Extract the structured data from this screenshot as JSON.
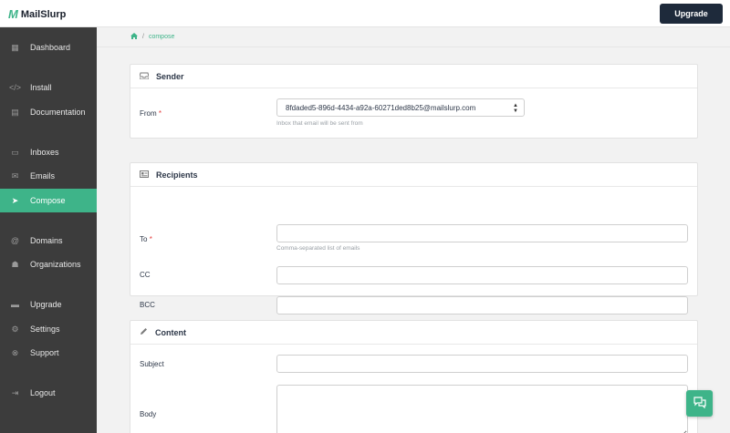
{
  "app": {
    "logo_mark": "M",
    "logo_text": "MailSlurp",
    "upgrade_label": "Upgrade"
  },
  "colors": {
    "accent": "#3eb489",
    "sidebar_bg": "#3c3c3c",
    "header_button": "#1e2a3b",
    "required": "#e53e3e"
  },
  "sidebar": {
    "items": [
      {
        "label": "Dashboard",
        "icon": "dashboard-icon",
        "glyph": "▦"
      },
      {
        "label": "Install",
        "icon": "code-icon",
        "glyph": "</>"
      },
      {
        "label": "Documentation",
        "icon": "book-icon",
        "glyph": "▤"
      },
      {
        "label": "Inboxes",
        "icon": "inbox-icon",
        "glyph": "▭"
      },
      {
        "label": "Emails",
        "icon": "envelope-icon",
        "glyph": "✉"
      },
      {
        "label": "Compose",
        "icon": "paper-plane-icon",
        "glyph": "➤",
        "active": true
      },
      {
        "label": "Domains",
        "icon": "at-icon",
        "glyph": "@"
      },
      {
        "label": "Organizations",
        "icon": "users-icon",
        "glyph": "☗"
      },
      {
        "label": "Upgrade",
        "icon": "credit-card-icon",
        "glyph": "▬"
      },
      {
        "label": "Settings",
        "icon": "gear-icon",
        "glyph": "⚙"
      },
      {
        "label": "Support",
        "icon": "life-ring-icon",
        "glyph": "⊗"
      },
      {
        "label": "Logout",
        "icon": "sign-out-icon",
        "glyph": "⇥"
      }
    ]
  },
  "breadcrumb": {
    "home_icon": "home-icon",
    "separator": "/",
    "current": "compose"
  },
  "sender": {
    "title": "Sender",
    "icon": "inbox-icon",
    "from_label": "From",
    "required_mark": "*",
    "from_value": "8fdaded5-896d-4434-a92a-60271ded8b25@mailslurp.com",
    "from_help": "Inbox that email will be sent from"
  },
  "recipients": {
    "title": "Recipients",
    "icon": "address-card-icon",
    "to_label": "To",
    "required_mark": "*",
    "to_help": "Comma-separated list of emails",
    "cc_label": "CC",
    "bcc_label": "BCC"
  },
  "content": {
    "title": "Content",
    "icon": "pencil-icon",
    "subject_label": "Subject",
    "body_label": "Body"
  },
  "chat": {
    "icon": "chat-bubbles-icon"
  }
}
